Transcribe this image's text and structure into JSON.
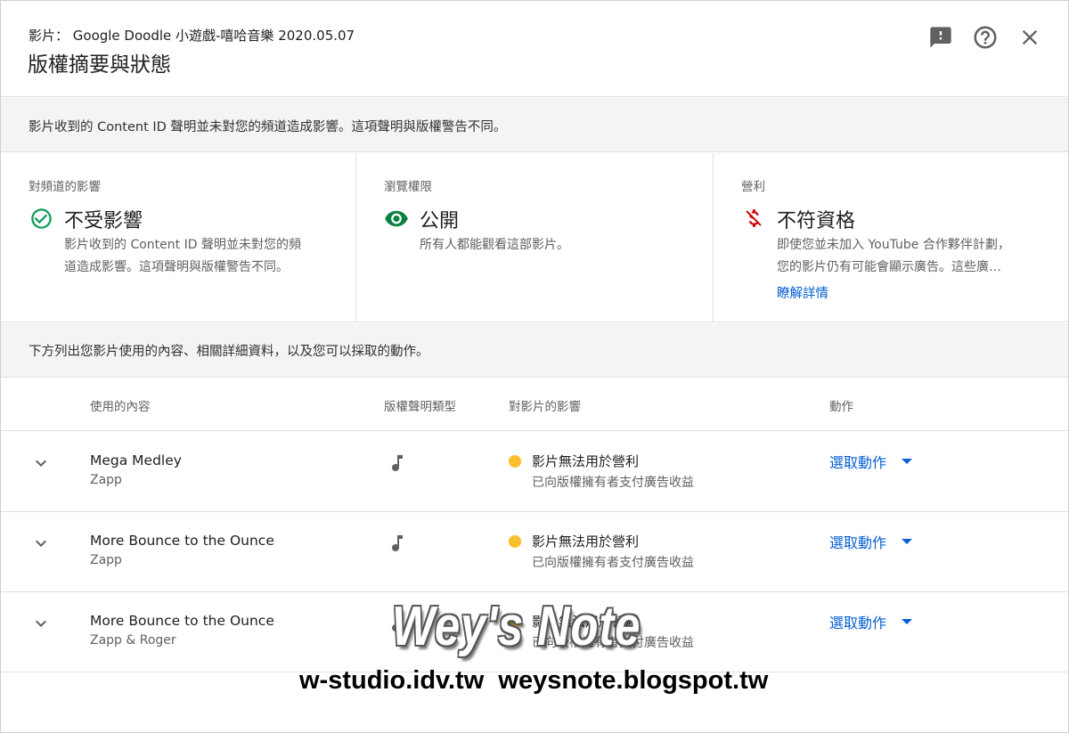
{
  "header": {
    "subtitle": "影片： Google Doodle 小遊戲-嘻哈音樂 2020.05.07",
    "title": "版權摘要與狀態",
    "icons": [
      "feedback-icon",
      "help-icon",
      "close-icon"
    ]
  },
  "notice": "影片收到的 Content ID 聲明並未對您的頻道造成影響。這項聲明與版權警告不同。",
  "cards": [
    {
      "label": "對頻道的影響",
      "icon": "check-circle-icon",
      "value": "不受影響",
      "desc": [
        "影片收到的 Content ID 聲明並未對您的頻",
        "道造成影響。這項聲明與版權警告不同。"
      ]
    },
    {
      "label": "瀏覽權限",
      "icon": "eye-icon",
      "value": "公開",
      "desc": [
        "所有人都能觀看這部影片。"
      ]
    },
    {
      "label": "營利",
      "icon": "no-monetization-icon",
      "value": "不符資格",
      "desc": [
        "即使您並未加入 YouTube 合作夥伴計劃，",
        "您的影片仍有可能會顯示廣告。這些廣…"
      ],
      "link": "瞭解詳情"
    }
  ],
  "section_notice": "下方列出您影片使用的內容、相關詳細資料，以及您可以採取的動作。",
  "table": {
    "headers": [
      "使用的內容",
      "版權聲明類型",
      "對影片的影響",
      "動作"
    ],
    "rows": [
      {
        "song": "Mega Medley",
        "artist": "Zapp",
        "type_icon": "music-note-icon",
        "impact": "影片無法用於營利",
        "impact_sub": "已向版權擁有者支付廣告收益",
        "action": "選取動作"
      },
      {
        "song": "More Bounce to the Ounce",
        "artist": "Zapp",
        "type_icon": "music-note-icon",
        "impact": "影片無法用於營利",
        "impact_sub": "已向版權擁有者支付廣告收益",
        "action": "選取動作"
      },
      {
        "song": "More Bounce to the Ounce",
        "artist": "Zapp & Roger",
        "type_icon": "music-note-icon",
        "impact": "影片無法用於營利",
        "impact_sub": "已向版權擁有者支付廣告收益",
        "action": "選取動作"
      }
    ]
  },
  "colors": {
    "accent": "#065fd4",
    "ok_green": "#0f9d58",
    "eye_green": "#0b8043",
    "warn_red": "#cc0000",
    "dot_yellow": "#f9bf2c"
  },
  "watermark": {
    "logo": "Wey's Note",
    "urls": "w-studio.idv.tw  weysnote.blogspot.tw"
  }
}
